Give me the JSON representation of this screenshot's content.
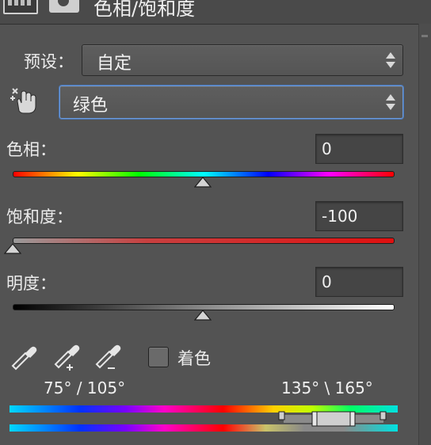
{
  "header": {
    "title": "色相/饱和度"
  },
  "preset": {
    "label": "预设：",
    "value": "自定"
  },
  "channel": {
    "value": "绿色"
  },
  "hue": {
    "label": "色相：",
    "value": "0"
  },
  "saturation": {
    "label": "饱和度：",
    "value": "-100"
  },
  "lightness": {
    "label": "明度：",
    "value": "0"
  },
  "colorize": {
    "label": "着色",
    "checked": false
  },
  "range": {
    "left": "75° / 105°",
    "right": "135° \\ 165°"
  },
  "sliders": {
    "hue_level": 0.5,
    "saturation_level": 0.0,
    "lightness_level": 0.5
  },
  "icons": [
    "adjustment-layer-icon",
    "mask-icon",
    "targeted-adjustment-hand-icon",
    "eyedropper-icon",
    "eyedropper-add-icon",
    "eyedropper-subtract-icon",
    "updown-arrows-icon"
  ],
  "colors": {
    "panel_bg": "#535353",
    "focus_border": "#6d9ad8",
    "saturation_track": "#cf1f1f"
  }
}
